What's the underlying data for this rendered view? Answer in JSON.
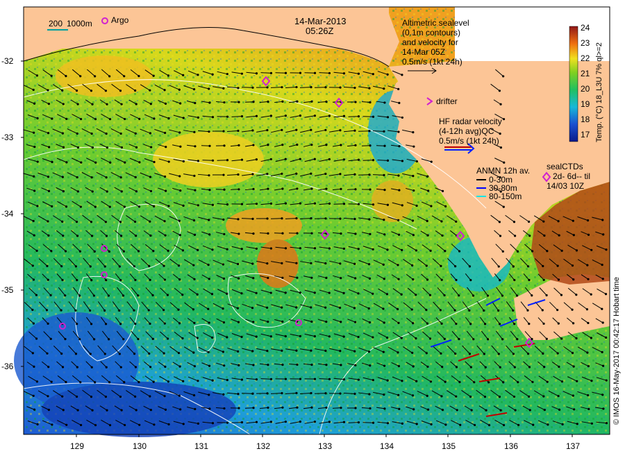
{
  "header": {
    "date": "14-Mar-2013",
    "time": "05:26Z"
  },
  "scale_legend": {
    "text_200": "200",
    "text_1000": "1000m",
    "argo_label": "Argo"
  },
  "altimetric_legend": {
    "line1": "Altimetric sealevel",
    "line2": "(0.1m contours)",
    "line3": "and velocity for",
    "line4": "14-Mar 05Z",
    "line5": "0.5m/s (1kt 24h)"
  },
  "drifter_legend": {
    "label": "drifter"
  },
  "hf_radar_legend": {
    "line1": "HF radar velocity",
    "line2": "(4-12h avg)QC",
    "line3": "0.5m/s (1kt 24h)"
  },
  "anmn_legend": {
    "title": "ANMN 12h av.",
    "items": [
      {
        "label": "0-30m",
        "color": "#000000"
      },
      {
        "label": "30-80m",
        "color": "#0000ff"
      },
      {
        "label": "80-150m",
        "color": "#00e5e5"
      }
    ]
  },
  "sealctd_legend": {
    "title": "sealCTDs",
    "line2": "2d- 6d-- til",
    "line3": "14/03 10Z"
  },
  "colorbar": {
    "label": "Temp. (°C) 18_L3U 7% ql>=2",
    "ticks": [
      "24",
      "23",
      "22",
      "21",
      "20",
      "19",
      "18",
      "17"
    ],
    "min": 16.8,
    "max": 24.2
  },
  "axes": {
    "lat_ticks": [
      "-32",
      "-33",
      "-34",
      "-35",
      "-36"
    ],
    "lon_ticks": [
      "129",
      "130",
      "131",
      "132",
      "133",
      "134",
      "135",
      "136",
      "137"
    ]
  },
  "credit": "© IMOS 16-May-2017 00:42:17 Hobart time",
  "colors": {
    "land": "#fcc596",
    "warm": "#a0261e",
    "cold": "#0a1a8a",
    "contour": "#ffffff",
    "argo_marker": "#d020d0",
    "hf_radar": "#c00000"
  }
}
